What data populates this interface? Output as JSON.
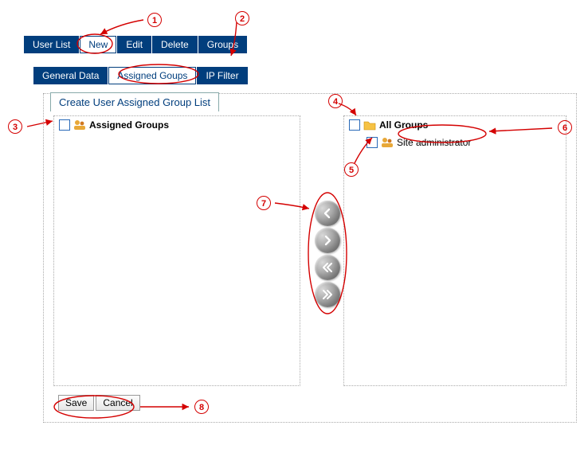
{
  "toolbar": {
    "user_list": "User List",
    "new": "New",
    "edit": "Edit",
    "delete": "Delete",
    "groups": "Groups"
  },
  "tabs": {
    "general_data": "General Data",
    "assigned_groups": "Assigned Goups",
    "ip_filter": "IP Filter"
  },
  "panel": {
    "title": "Create User Assigned Group List",
    "left_header": "Assigned Groups",
    "right_header": "All Groups",
    "right_item_1": "Site administrator"
  },
  "buttons": {
    "save": "Save",
    "cancel": "Cancel"
  },
  "callouts": {
    "1": "1",
    "2": "2",
    "3": "3",
    "4": "4",
    "5": "5",
    "6": "6",
    "7": "7",
    "8": "8"
  }
}
